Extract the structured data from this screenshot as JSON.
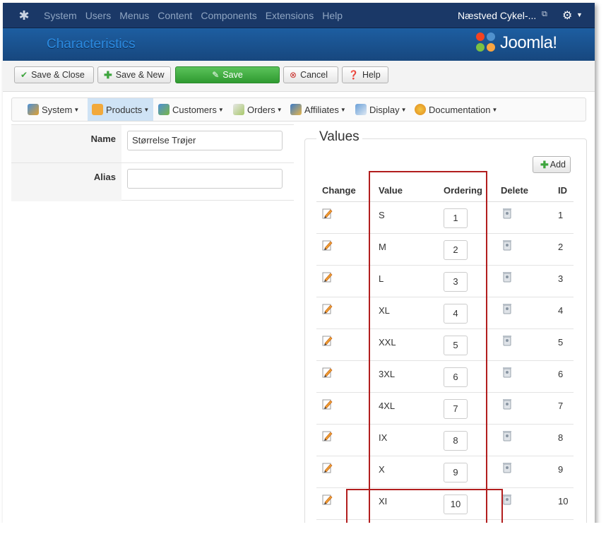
{
  "topbar": {
    "menu": [
      "System",
      "Users",
      "Menus",
      "Content",
      "Components",
      "Extensions",
      "Help"
    ],
    "site_name": "Næstved Cykel-...",
    "icons": {
      "logo": "joomla-icon",
      "external": "external-link-icon",
      "settings": "gear-icon"
    }
  },
  "header": {
    "title": "Characteristics",
    "brand": "Joomla!"
  },
  "toolbar": {
    "save_close": "Save & Close",
    "save_new": "Save & New",
    "save": "Save",
    "cancel": "Cancel",
    "help": "Help"
  },
  "submenu": {
    "items": [
      "System",
      "Products",
      "Customers",
      "Orders",
      "Affiliates",
      "Display",
      "Documentation"
    ],
    "active": "Products"
  },
  "form": {
    "name_label": "Name",
    "name_value": "Størrelse Trøjer",
    "alias_label": "Alias",
    "alias_value": ""
  },
  "values": {
    "legend": "Values",
    "add_label": "Add",
    "columns": {
      "change": "Change",
      "value": "Value",
      "ordering": "Ordering",
      "delete": "Delete",
      "id": "ID"
    },
    "rows": [
      {
        "value": "S",
        "ordering": "1",
        "id": "1"
      },
      {
        "value": "M",
        "ordering": "2",
        "id": "2"
      },
      {
        "value": "L",
        "ordering": "3",
        "id": "3"
      },
      {
        "value": "XL",
        "ordering": "4",
        "id": "4"
      },
      {
        "value": "XXL",
        "ordering": "5",
        "id": "5"
      },
      {
        "value": "3XL",
        "ordering": "6",
        "id": "6"
      },
      {
        "value": "4XL",
        "ordering": "7",
        "id": "7"
      },
      {
        "value": "IX",
        "ordering": "8",
        "id": "8"
      },
      {
        "value": "X",
        "ordering": "9",
        "id": "9"
      },
      {
        "value": "XI",
        "ordering": "10",
        "id": "10"
      }
    ]
  },
  "colors": {
    "navbar": "#1a3867",
    "header": "#1c5998",
    "title": "#2b8ae0",
    "save_green": "#3ea53e",
    "highlight": "#b21e1e"
  }
}
